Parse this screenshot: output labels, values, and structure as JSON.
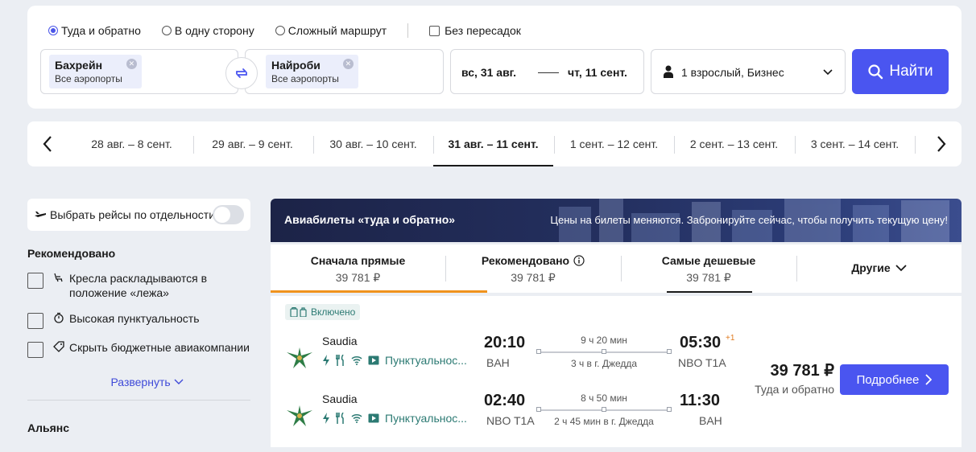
{
  "search": {
    "trip_types": [
      {
        "label": "Туда и обратно",
        "selected": true
      },
      {
        "label": "В одну сторону",
        "selected": false
      },
      {
        "label": "Сложный маршрут",
        "selected": false
      }
    ],
    "nonstop_label": "Без пересадок",
    "from": {
      "city": "Бахрейн",
      "airports": "Все аэропорты"
    },
    "to": {
      "city": "Найроби",
      "airports": "Все аэропорты"
    },
    "date_out": "вс, 31 авг.",
    "date_back": "чт, 11 сент.",
    "passengers": "1 взрослый, Бизнес",
    "find_label": "Найти"
  },
  "date_strip": {
    "items": [
      "28 авг. – 8 сент.",
      "29 авг. – 9 сент.",
      "30 авг. – 10 сент.",
      "31 авг. – 11 сент.",
      "1 сент. – 12 сент.",
      "2 сент. – 13 сент.",
      "3 сент. – 14 сент."
    ],
    "active_index": 3
  },
  "filters": {
    "toggle_label": "Выбрать рейсы по отдельности",
    "recommended_title": "Рекомендовано",
    "items": [
      "Кресла раскладываются в положение «лежа»",
      "Высокая пунктуальность",
      "Скрыть бюджетные авиакомпании"
    ],
    "expand_label": "Развернуть",
    "alliance_title": "Альянс"
  },
  "banner": {
    "title": "Авиабилеты «туда и обратно»",
    "note": "Цены на билеты меняются. Забронируйте сейчас, чтобы получить текущую цену!"
  },
  "sort_tabs": [
    {
      "label": "Сначала прямые",
      "price": "39 781 ₽"
    },
    {
      "label": "Рекомендовано",
      "price": "39 781 ₽"
    },
    {
      "label": "Самые дешевые",
      "price": "39 781 ₽"
    },
    {
      "label": "Другие",
      "price": ""
    }
  ],
  "ticket": {
    "included_label": "Включено",
    "legs": [
      {
        "airline": "Saudia",
        "punctuality": "Пунктуальнос...",
        "dep_time": "20:10",
        "dep_code": "BAH",
        "duration": "9 ч 20 мин",
        "stop": "3 ч в г. Джедда",
        "arr_time": "05:30",
        "arr_code": "NBO T1A",
        "plus_day": "+1"
      },
      {
        "airline": "Saudia",
        "punctuality": "Пунктуальнос...",
        "dep_time": "02:40",
        "dep_code": "NBO T1A",
        "duration": "8 ч 50 мин",
        "stop": "2 ч 45 мин в г. Джедда",
        "arr_time": "11:30",
        "arr_code": "BAH",
        "plus_day": ""
      }
    ],
    "price": "39 781 ₽",
    "price_note": "Туда и обратно",
    "details_label": "Подробнее"
  },
  "colors": {
    "accent": "#4a55f0",
    "teal": "#2c7a73",
    "orange": "#f0931e",
    "banner": "#1c2347"
  }
}
